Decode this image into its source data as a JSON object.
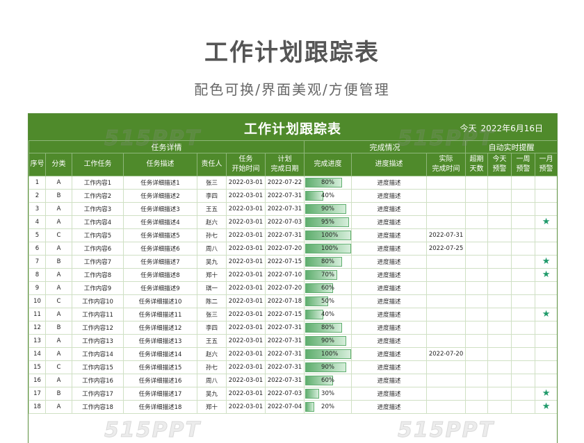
{
  "page": {
    "title": "工作计划跟踪表",
    "subtitle": "配色可换/界面美观/方便管理"
  },
  "sheet": {
    "title": "工作计划跟踪表",
    "today_label": "今天",
    "today_value": "2022年6月16日"
  },
  "groups": {
    "task_details": "任务详情",
    "completion": "完成情况",
    "reminder": "自动实时提醒"
  },
  "columns": {
    "index": "序号",
    "category": "分类",
    "task": "工作任务",
    "desc": "任务描述",
    "owner": "责任人",
    "start_l1": "任务",
    "start_l2": "开始时间",
    "plan_l1": "计划",
    "plan_l2": "完成日期",
    "progress": "完成进度",
    "progress_desc": "进度描述",
    "actual_l1": "实际",
    "actual_l2": "完成时间",
    "overdue_l1": "超期",
    "overdue_l2": "天数",
    "today_l1": "今天",
    "today_l2": "预警",
    "week_l1": "一周",
    "week_l2": "预警",
    "month_l1": "一月",
    "month_l2": "预警"
  },
  "accent_color": "#4f8a2b",
  "star_color": "#1f9a6a",
  "star_icon": "star-icon",
  "rows": [
    {
      "no": "1",
      "cat": "A",
      "task": "工作内容1",
      "desc": "任务详细描述1",
      "owner": "张三",
      "start": "2022-03-01",
      "plan": "2022-07-22",
      "progress": "80%",
      "pct": 80,
      "pdesc": "进度描述",
      "actual": "",
      "star": false
    },
    {
      "no": "2",
      "cat": "B",
      "task": "工作内容2",
      "desc": "任务详细描述2",
      "owner": "李四",
      "start": "2022-03-01",
      "plan": "2022-07-31",
      "progress": "40%",
      "pct": 40,
      "pdesc": "进度描述",
      "actual": "",
      "star": false
    },
    {
      "no": "3",
      "cat": "A",
      "task": "工作内容3",
      "desc": "任务详细描述3",
      "owner": "王五",
      "start": "2022-03-01",
      "plan": "2022-07-31",
      "progress": "90%",
      "pct": 90,
      "pdesc": "进度描述",
      "actual": "",
      "star": false
    },
    {
      "no": "4",
      "cat": "A",
      "task": "工作内容4",
      "desc": "任务详细描述4",
      "owner": "赵六",
      "start": "2022-03-01",
      "plan": "2022-07-03",
      "progress": "95%",
      "pct": 95,
      "pdesc": "进度描述",
      "actual": "",
      "star": true
    },
    {
      "no": "5",
      "cat": "C",
      "task": "工作内容5",
      "desc": "任务详细描述5",
      "owner": "孙七",
      "start": "2022-03-01",
      "plan": "2022-07-31",
      "progress": "100%",
      "pct": 100,
      "pdesc": "进度描述",
      "actual": "2022-07-31",
      "star": false
    },
    {
      "no": "6",
      "cat": "A",
      "task": "工作内容6",
      "desc": "任务详细描述6",
      "owner": "周八",
      "start": "2022-03-01",
      "plan": "2022-07-20",
      "progress": "100%",
      "pct": 100,
      "pdesc": "进度描述",
      "actual": "2022-07-25",
      "star": false
    },
    {
      "no": "7",
      "cat": "B",
      "task": "工作内容7",
      "desc": "任务详细描述7",
      "owner": "吴九",
      "start": "2022-03-01",
      "plan": "2022-07-15",
      "progress": "80%",
      "pct": 80,
      "pdesc": "进度描述",
      "actual": "",
      "star": true
    },
    {
      "no": "8",
      "cat": "A",
      "task": "工作内容8",
      "desc": "任务详细描述8",
      "owner": "郑十",
      "start": "2022-03-01",
      "plan": "2022-07-10",
      "progress": "70%",
      "pct": 70,
      "pdesc": "进度描述",
      "actual": "",
      "star": true
    },
    {
      "no": "9",
      "cat": "A",
      "task": "工作内容9",
      "desc": "任务详细描述9",
      "owner": "琪一",
      "start": "2022-03-01",
      "plan": "2022-07-20",
      "progress": "60%",
      "pct": 60,
      "pdesc": "进度描述",
      "actual": "",
      "star": false
    },
    {
      "no": "10",
      "cat": "C",
      "task": "工作内容10",
      "desc": "任务详细描述10",
      "owner": "陈二",
      "start": "2022-03-01",
      "plan": "2022-07-18",
      "progress": "50%",
      "pct": 50,
      "pdesc": "进度描述",
      "actual": "",
      "star": false
    },
    {
      "no": "11",
      "cat": "A",
      "task": "工作内容11",
      "desc": "任务详细描述11",
      "owner": "张三",
      "start": "2022-03-01",
      "plan": "2022-07-15",
      "progress": "40%",
      "pct": 40,
      "pdesc": "进度描述",
      "actual": "",
      "star": true
    },
    {
      "no": "12",
      "cat": "B",
      "task": "工作内容12",
      "desc": "任务详细描述12",
      "owner": "李四",
      "start": "2022-03-01",
      "plan": "2022-07-31",
      "progress": "80%",
      "pct": 80,
      "pdesc": "进度描述",
      "actual": "",
      "star": false
    },
    {
      "no": "13",
      "cat": "A",
      "task": "工作内容13",
      "desc": "任务详细描述13",
      "owner": "王五",
      "start": "2022-03-01",
      "plan": "2022-07-31",
      "progress": "90%",
      "pct": 90,
      "pdesc": "进度描述",
      "actual": "",
      "star": false
    },
    {
      "no": "14",
      "cat": "A",
      "task": "工作内容14",
      "desc": "任务详细描述14",
      "owner": "赵六",
      "start": "2022-03-01",
      "plan": "2022-07-31",
      "progress": "100%",
      "pct": 100,
      "pdesc": "进度描述",
      "actual": "2022-07-20",
      "star": false
    },
    {
      "no": "15",
      "cat": "C",
      "task": "工作内容15",
      "desc": "任务详细描述15",
      "owner": "孙七",
      "start": "2022-03-01",
      "plan": "2022-07-31",
      "progress": "90%",
      "pct": 90,
      "pdesc": "进度描述",
      "actual": "",
      "star": false
    },
    {
      "no": "16",
      "cat": "A",
      "task": "工作内容16",
      "desc": "任务详细描述16",
      "owner": "周八",
      "start": "2022-03-01",
      "plan": "2022-07-31",
      "progress": "60%",
      "pct": 60,
      "pdesc": "进度描述",
      "actual": "",
      "star": false
    },
    {
      "no": "17",
      "cat": "B",
      "task": "工作内容17",
      "desc": "任务详细描述17",
      "owner": "吴九",
      "start": "2022-03-01",
      "plan": "2022-07-03",
      "progress": "30%",
      "pct": 30,
      "pdesc": "进度描述",
      "actual": "",
      "star": true
    },
    {
      "no": "18",
      "cat": "A",
      "task": "工作内容18",
      "desc": "任务详细描述18",
      "owner": "郑十",
      "start": "2022-03-01",
      "plan": "2022-07-04",
      "progress": "20%",
      "pct": 20,
      "pdesc": "进度描述",
      "actual": "",
      "star": true
    }
  ],
  "watermark": "515PPT"
}
